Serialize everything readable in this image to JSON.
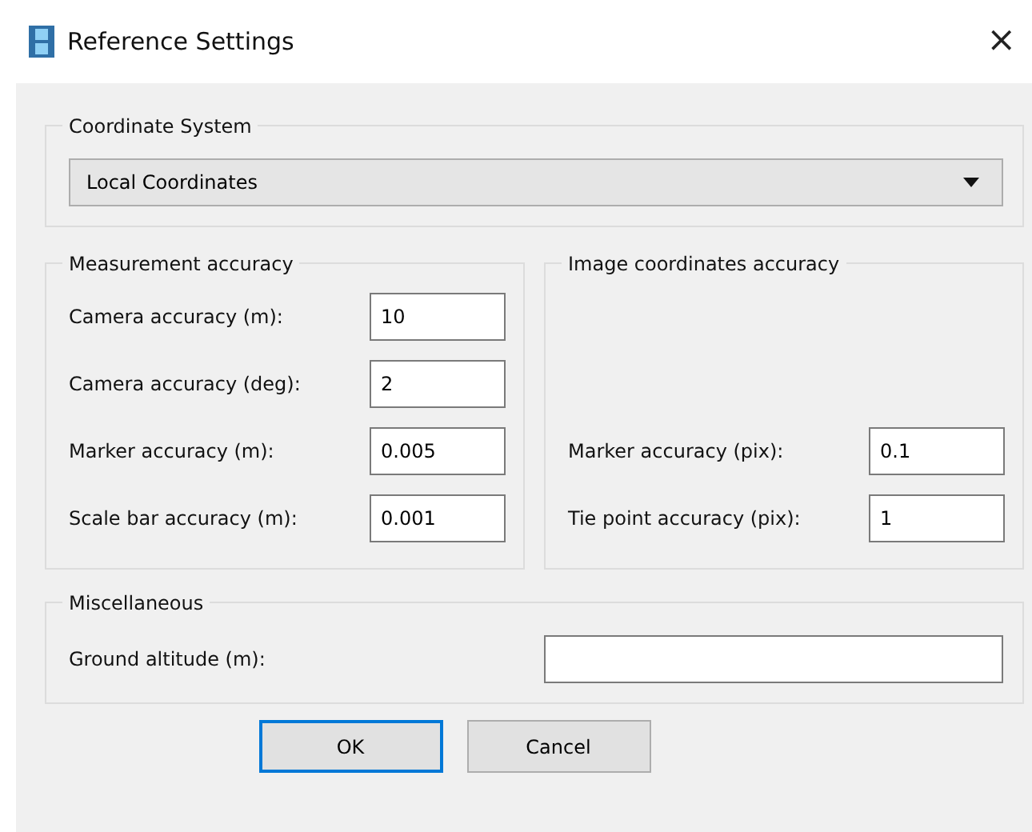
{
  "window": {
    "title": "Reference Settings",
    "close": "×"
  },
  "coordinate_system": {
    "title": "Coordinate System",
    "value": "Local Coordinates"
  },
  "measurement_accuracy": {
    "title": "Measurement accuracy",
    "fields": [
      {
        "label": "Camera accuracy (m):",
        "value": "10"
      },
      {
        "label": "Camera accuracy (deg):",
        "value": "2"
      },
      {
        "label": "Marker accuracy (m):",
        "value": "0.005"
      },
      {
        "label": "Scale bar accuracy (m):",
        "value": "0.001"
      }
    ]
  },
  "image_coordinates_accuracy": {
    "title": "Image coordinates accuracy",
    "fields": [
      {
        "label": "Marker accuracy (pix):",
        "value": "0.1"
      },
      {
        "label": "Tie point accuracy (pix):",
        "value": "1"
      }
    ]
  },
  "miscellaneous": {
    "title": "Miscellaneous",
    "fields": [
      {
        "label": "Ground altitude (m):"
      }
    ]
  },
  "buttons": [
    {
      "label": "OK",
      "default": true
    },
    {
      "label": "Cancel",
      "default": false
    }
  ]
}
